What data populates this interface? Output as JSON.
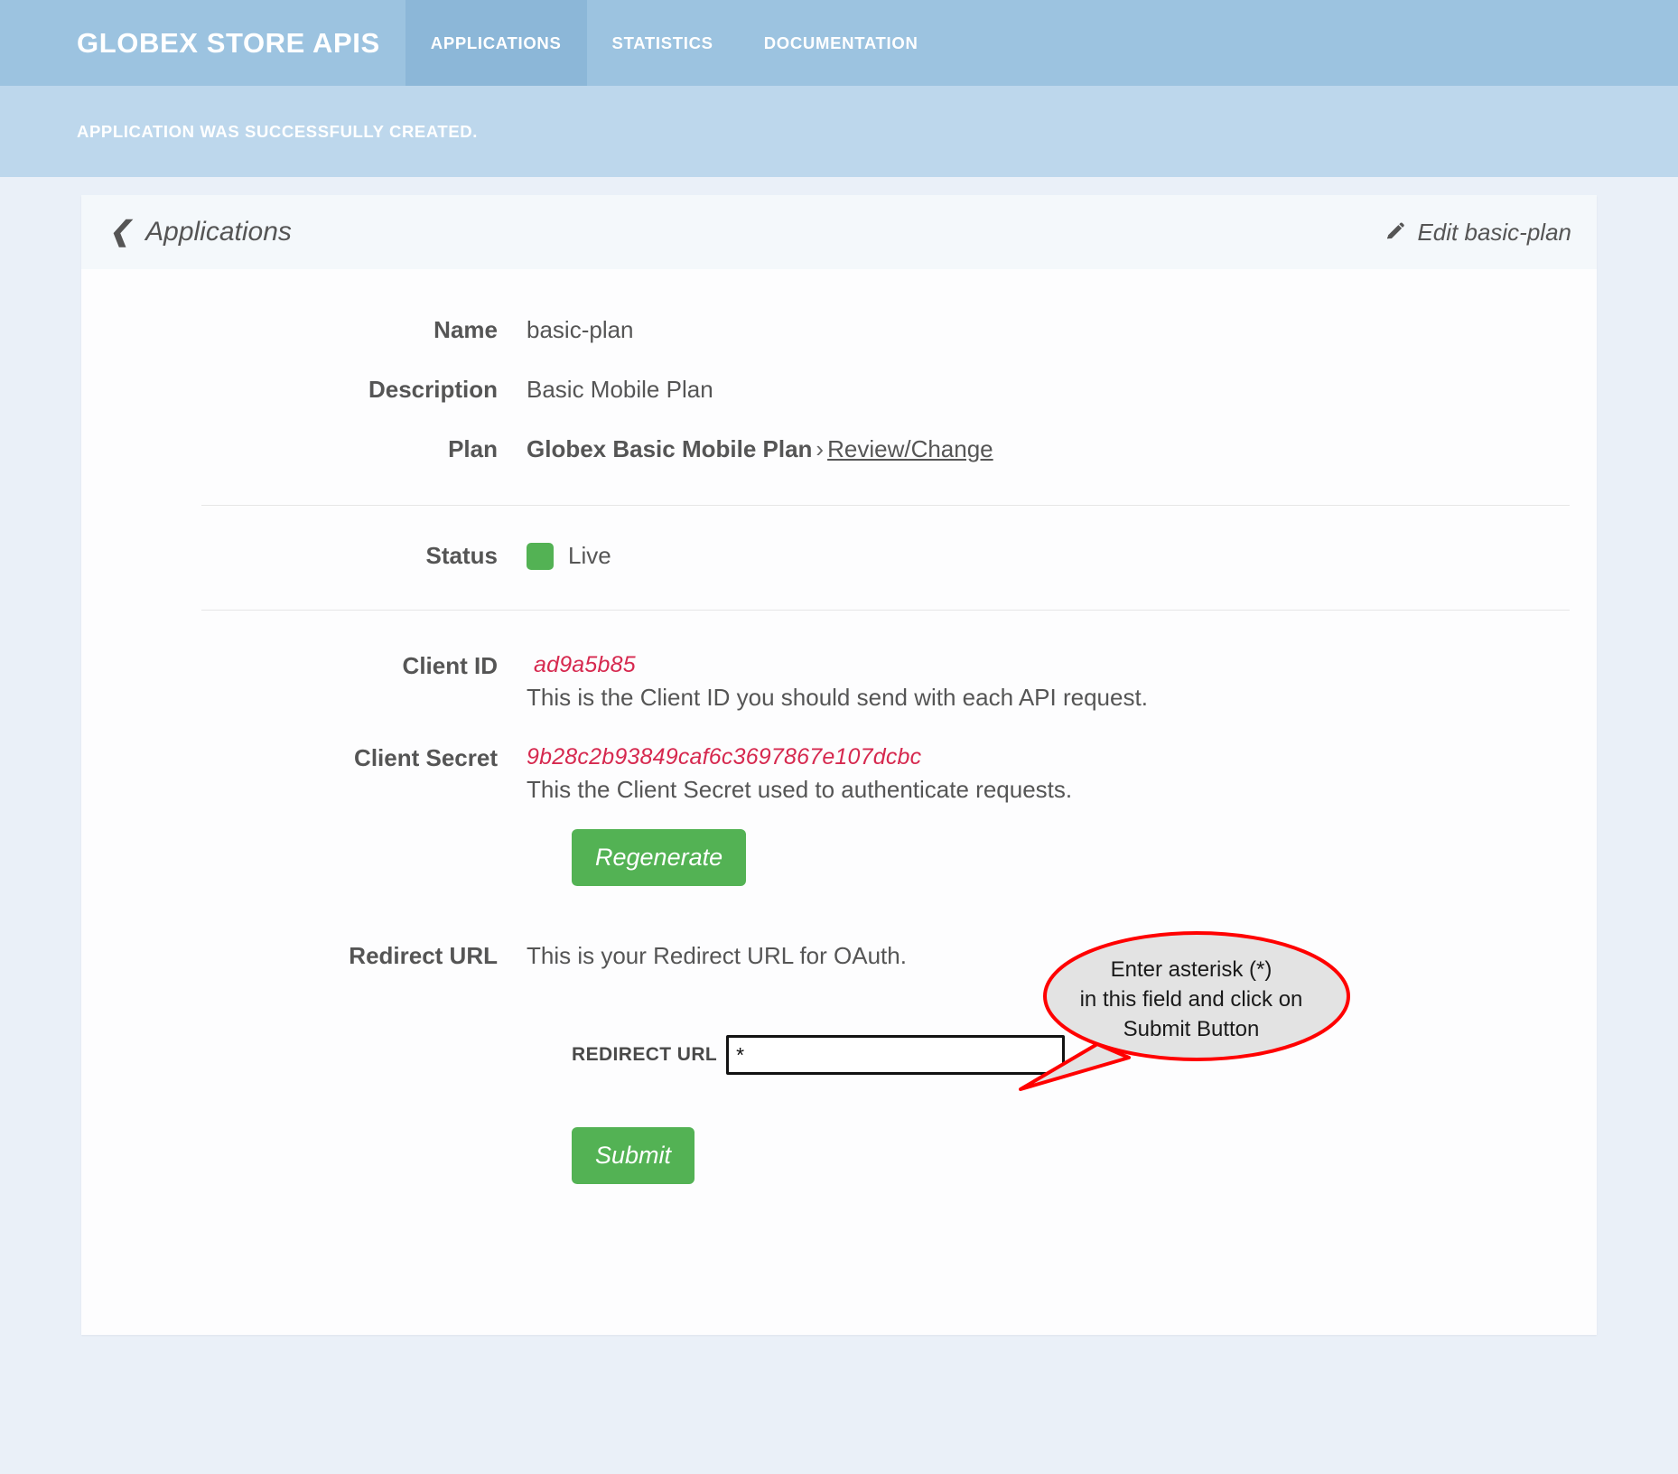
{
  "navbar": {
    "brand": "GLOBEX STORE APIS",
    "items": [
      {
        "label": "APPLICATIONS",
        "active": true
      },
      {
        "label": "STATISTICS",
        "active": false
      },
      {
        "label": "DOCUMENTATION",
        "active": false
      }
    ]
  },
  "flash": {
    "message": "APPLICATION WAS SUCCESSFULLY CREATED."
  },
  "card": {
    "back_link": "Applications",
    "back_icon": "chevron-left-icon",
    "edit_link": "Edit basic-plan",
    "edit_icon": "pencil-icon"
  },
  "fields": {
    "name_label": "Name",
    "name_value": "basic-plan",
    "description_label": "Description",
    "description_value": "Basic Mobile Plan",
    "plan_label": "Plan",
    "plan_value": "Globex Basic Mobile Plan",
    "plan_separator": "›",
    "plan_link": "Review/Change",
    "status_label": "Status",
    "status_value": "Live",
    "status_color": "#53b254",
    "client_id_label": "Client ID",
    "client_id_value": "ad9a5b85",
    "client_id_help": "This is the Client ID you should send with each API request.",
    "client_secret_label": "Client Secret",
    "client_secret_value": "9b28c2b93849caf6c3697867e107dcbc",
    "client_secret_help": "This the Client Secret used to authenticate requests.",
    "secret_color": "#d6294f",
    "regenerate_label": "Regenerate",
    "redirect_label": "Redirect URL",
    "redirect_help": "This is your Redirect URL for OAuth.",
    "redirect_field_label": "REDIRECT URL",
    "redirect_input_value": "*",
    "redirect_input_placeholder": "",
    "submit_label": "Submit"
  },
  "callout": {
    "line1": "Enter asterisk (*)",
    "line2": "in this field and click on",
    "line3": "Submit Button",
    "text": "Enter asterisk (*) in this field and click on Submit Button",
    "border_color": "#ff0000",
    "fill_color": "#e3e3e3"
  },
  "theme": {
    "navbar_bg": "#9cc3e0",
    "navbar_active_bg": "#8cb7d8",
    "flash_bg": "#bdd7ec",
    "page_bg": "#eaf0f8",
    "card_bg": "#fdfdfe",
    "card_header_bg": "#f4f8fb",
    "green": "#53b254"
  }
}
